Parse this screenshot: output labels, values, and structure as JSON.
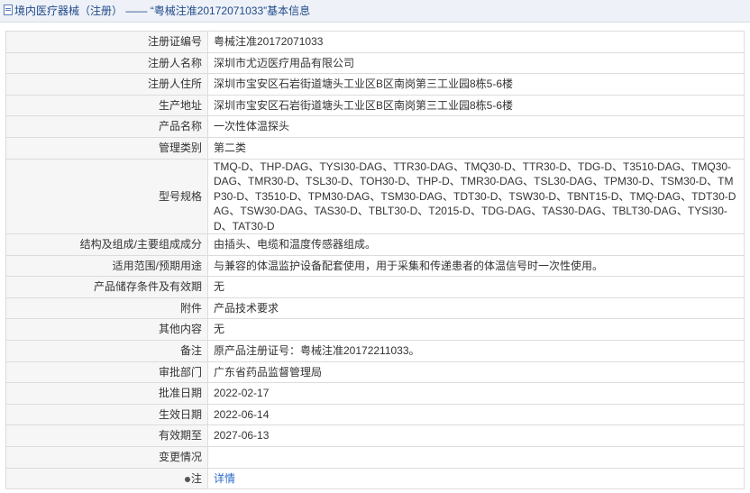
{
  "header": {
    "category": "境内医疗器械（注册）",
    "separator": "——",
    "title": "“粤械注准20172071033”基本信息"
  },
  "rows": [
    {
      "label": "注册证编号",
      "value": "粤械注准20172071033"
    },
    {
      "label": "注册人名称",
      "value": "深圳市尤迈医疗用品有限公司"
    },
    {
      "label": "注册人住所",
      "value": "深圳市宝安区石岩街道塘头工业区B区南岗第三工业园8栋5-6楼"
    },
    {
      "label": "生产地址",
      "value": "深圳市宝安区石岩街道塘头工业区B区南岗第三工业园8栋5-6楼"
    },
    {
      "label": "产品名称",
      "value": "一次性体温探头"
    },
    {
      "label": "管理类别",
      "value": "第二类"
    },
    {
      "label": "型号规格",
      "value": "TMQ-D、THP-DAG、TYSI30-DAG、TTR30-DAG、TMQ30-D、TTR30-D、TDG-D、T3510-DAG、TMQ30-DAG、TMR30-D、TSL30-D、TOH30-D、THP-D、TMR30-DAG、TSL30-DAG、TPM30-D、TSM30-D、TMP30-D、T3510-D、TPM30-DAG、TSM30-DAG、TDT30-D、TSW30-D、TBNT15-D、TMQ-DAG、TDT30-DAG、TSW30-DAG、TAS30-D、TBLT30-D、T2015-D、TDG-DAG、TAS30-DAG、TBLT30-DAG、TYSI30-D、TAT30-D"
    },
    {
      "label": "结构及组成/主要组成成分",
      "value": "由插头、电缆和温度传感器组成。"
    },
    {
      "label": "适用范围/预期用途",
      "value": "与兼容的体温监护设备配套使用，用于采集和传递患者的体温信号时一次性使用。"
    },
    {
      "label": "产品储存条件及有效期",
      "value": "无"
    },
    {
      "label": "附件",
      "value": "产品技术要求"
    },
    {
      "label": "其他内容",
      "value": "无"
    },
    {
      "label": "备注",
      "value": "原产品注册证号：粤械注准20172211033。"
    },
    {
      "label": "审批部门",
      "value": "广东省药品监督管理局"
    },
    {
      "label": "批准日期",
      "value": "2022-02-17"
    },
    {
      "label": "生效日期",
      "value": "2022-06-14"
    },
    {
      "label": "有效期至",
      "value": "2027-06-13"
    },
    {
      "label": "变更情况",
      "value": ""
    }
  ],
  "note_row": {
    "label": "注",
    "link": "详情",
    "icon": "pin-icon"
  }
}
